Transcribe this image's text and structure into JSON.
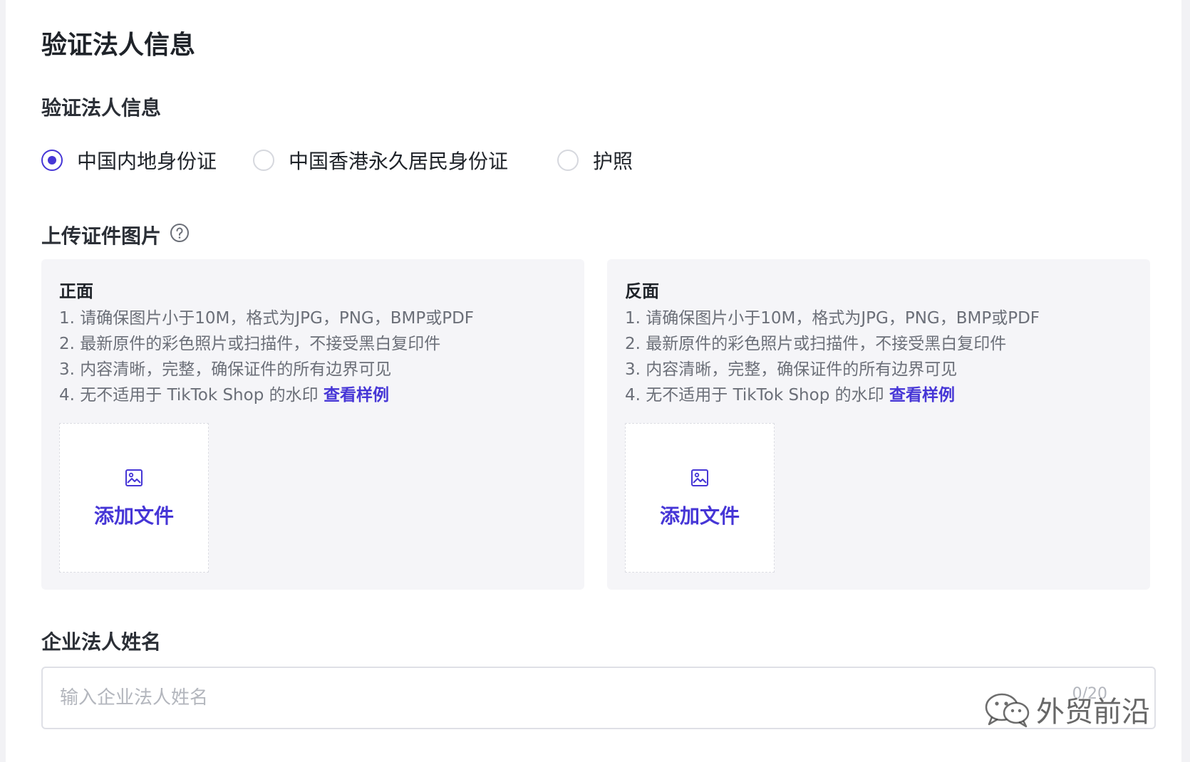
{
  "page": {
    "title": "验证法人信息"
  },
  "id_type": {
    "label": "验证法人信息",
    "options": [
      {
        "label": "中国内地身份证",
        "selected": true
      },
      {
        "label": "中国香港永久居民身份证",
        "selected": false
      },
      {
        "label": "护照",
        "selected": false
      }
    ]
  },
  "upload": {
    "label": "上传证件图片",
    "help_icon": "question-circle-icon",
    "cards": [
      {
        "title": "正面",
        "requirements": [
          "1. 请确保图片小于10M，格式为JPG，PNG，BMP或PDF",
          "2. 最新原件的彩色照片或扫描件，不接受黑白复印件",
          "3. 内容清晰，完整，确保证件的所有边界可见",
          "4. 无不适用于 TikTok Shop 的水印"
        ],
        "sample_link": "查看样例",
        "upload_icon": "image-icon",
        "upload_label": "添加文件"
      },
      {
        "title": "反面",
        "requirements": [
          "1. 请确保图片小于10M，格式为JPG，PNG，BMP或PDF",
          "2. 最新原件的彩色照片或扫描件，不接受黑白复印件",
          "3. 内容清晰，完整，确保证件的所有边界可见",
          "4. 无不适用于 TikTok Shop 的水印"
        ],
        "sample_link": "查看样例",
        "upload_icon": "image-icon",
        "upload_label": "添加文件"
      }
    ]
  },
  "legal_name": {
    "label": "企业法人姓名",
    "value": "",
    "placeholder": "输入企业法人姓名",
    "count": "0/20"
  },
  "watermark": {
    "icon": "wechat-icon",
    "text": "外贸前沿"
  },
  "colors": {
    "accent": "#4636d6",
    "card_bg": "#f5f5f8",
    "text_muted": "#6b6f78",
    "placeholder": "#b3b6bd"
  }
}
